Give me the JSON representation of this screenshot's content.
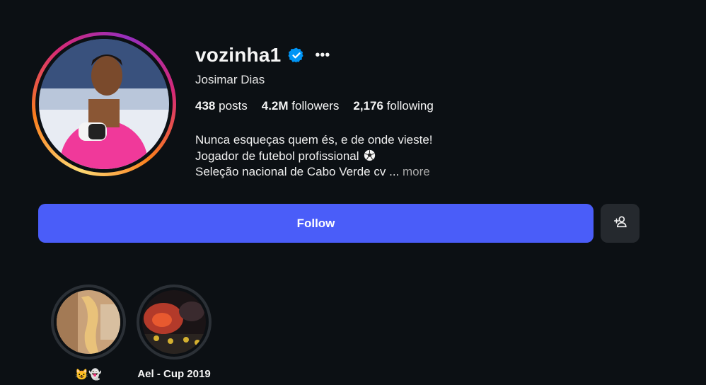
{
  "profile": {
    "username": "vozinha1",
    "full_name": "Josimar Dias",
    "more_icon": "•••",
    "stats": {
      "posts_count": "438",
      "posts_label": "posts",
      "followers_count": "4.2M",
      "followers_label": "followers",
      "following_count": "2,176",
      "following_label": "following"
    },
    "bio": {
      "line1": "Nunca esqueças quem és, e de onde vieste!",
      "line2": "Jogador de futebol profissional",
      "line3": "Seleção nacional de Cabo Verde cv",
      "ellipsis": "...",
      "more_label": "more"
    }
  },
  "actions": {
    "follow_label": "Follow",
    "suggest_icon": "add-person-icon"
  },
  "highlights": [
    {
      "label": "😺👻"
    },
    {
      "label": "Ael - Cup 2019"
    }
  ],
  "colors": {
    "background": "#0c1014",
    "follow_button": "#4a5df9",
    "secondary_button": "#25292e",
    "verified": "#0095f6",
    "muted_text": "#a8a8a8"
  }
}
